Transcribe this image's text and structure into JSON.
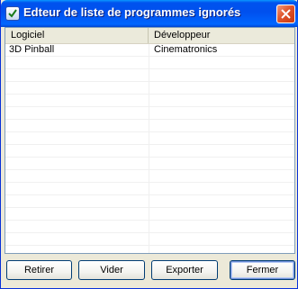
{
  "window": {
    "title": "Edteur de liste de programmes ignorés"
  },
  "table": {
    "columns": [
      "Logiciel",
      "Développeur"
    ],
    "rows": [
      {
        "software": "3D Pinball",
        "developer": "Cinematronics"
      }
    ]
  },
  "buttons": {
    "remove": "Retirer",
    "clear": "Vider",
    "export": "Exporter",
    "close": "Fermer"
  }
}
